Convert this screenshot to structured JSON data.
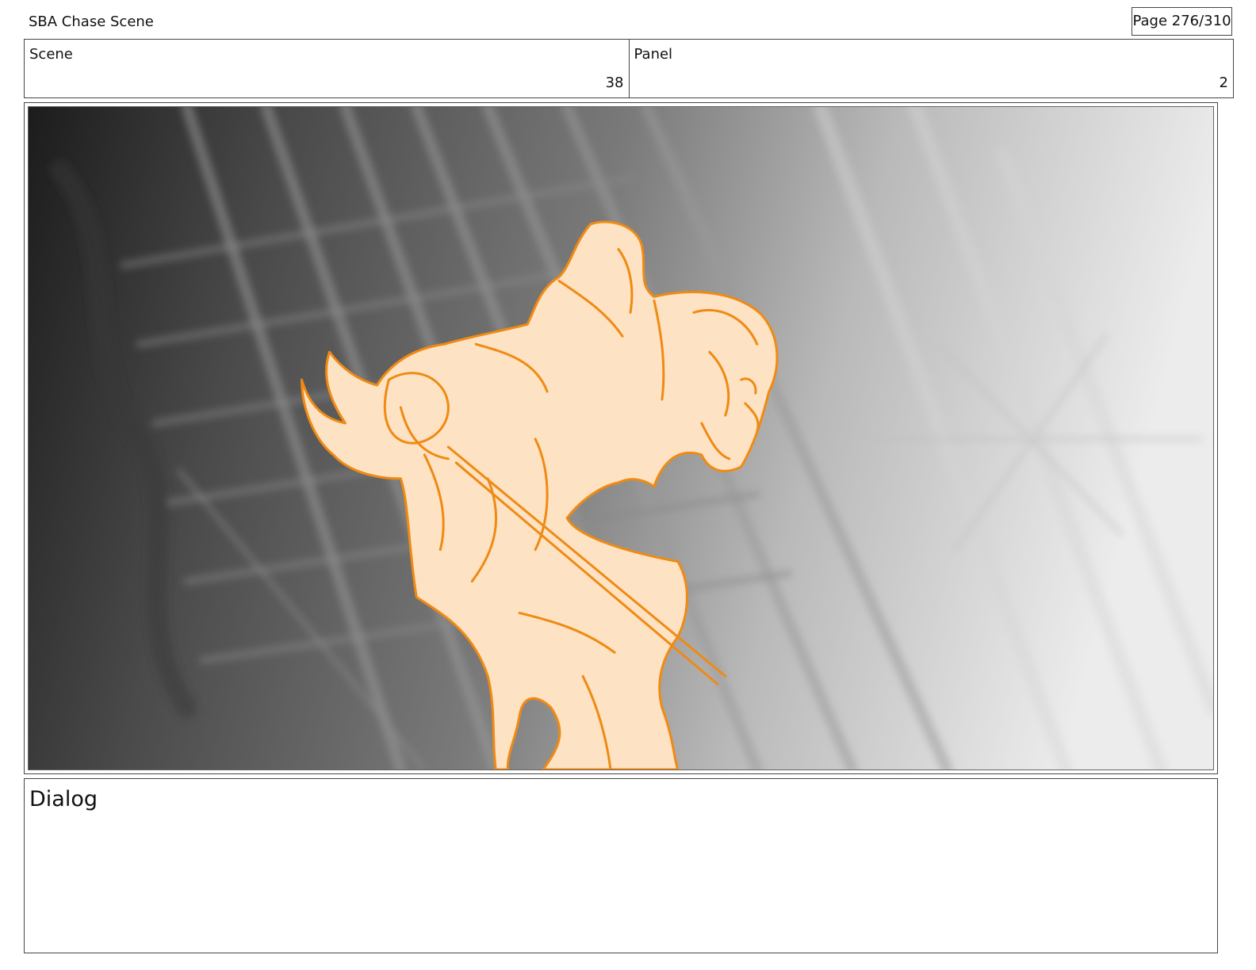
{
  "header": {
    "project_title": "SBA Chase Scene",
    "page": "Page 276/310"
  },
  "info": {
    "scene_label": "Scene",
    "scene_value": "38",
    "panel_label": "Panel",
    "panel_value": "2"
  },
  "colors": {
    "sketch_fill": "#fde2c4",
    "sketch_stroke": "#f08a12"
  },
  "dialog": {
    "label": "Dialog"
  }
}
